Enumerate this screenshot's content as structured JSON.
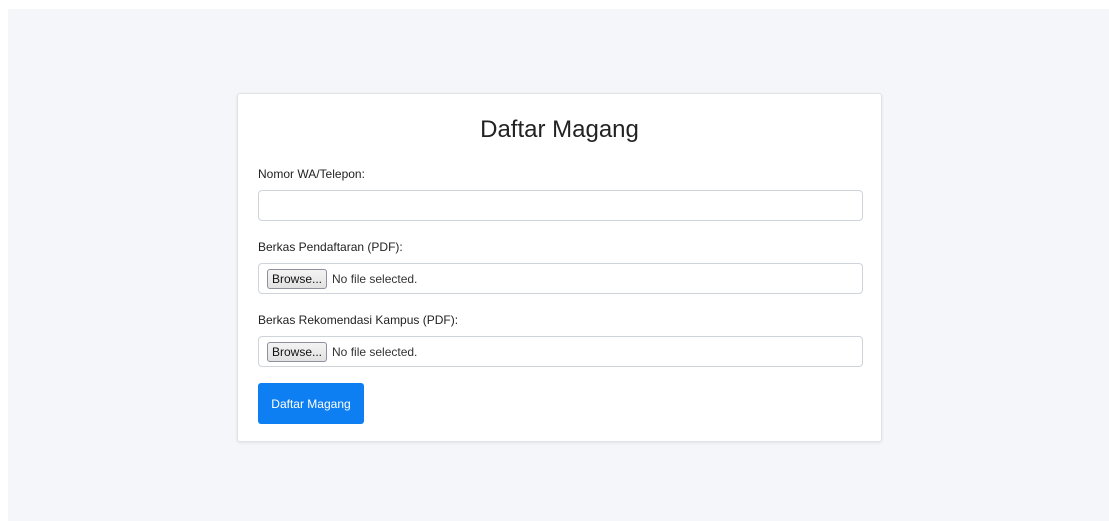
{
  "form": {
    "title": "Daftar Magang",
    "phone_label": "Nomor WA/Telepon:",
    "phone_value": "",
    "phone_placeholder": "",
    "registration_file_label": "Berkas Pendaftaran (PDF):",
    "registration_browse_label": "Browse...",
    "registration_file_status": "No file selected.",
    "recommendation_file_label": "Berkas Rekomendasi Kampus (PDF):",
    "recommendation_browse_label": "Browse...",
    "recommendation_file_status": "No file selected.",
    "submit_label": "Daftar Magang"
  },
  "colors": {
    "page_background": "#f4f6f9",
    "card_background": "#ffffff",
    "primary_button": "#0d7ff2"
  }
}
